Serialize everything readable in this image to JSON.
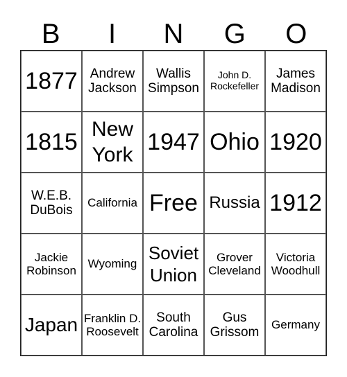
{
  "header": [
    "B",
    "I",
    "N",
    "G",
    "O"
  ],
  "cells": [
    [
      "1877",
      "Andrew Jackson",
      "Wallis Simpson",
      "John D. Rockefeller",
      "James Madison"
    ],
    [
      "1815",
      "New York",
      "1947",
      "Ohio",
      "1920"
    ],
    [
      "W.E.B. DuBois",
      "California",
      "Free",
      "Russia",
      "1912"
    ],
    [
      "Jackie Robinson",
      "Wyoming",
      "Soviet Union",
      "Grover Cleveland",
      "Victoria Woodhull"
    ],
    [
      "Japan",
      "Franklin D. Roosevelt",
      "South Carolina",
      "Gus Grissom",
      "Germany"
    ]
  ]
}
